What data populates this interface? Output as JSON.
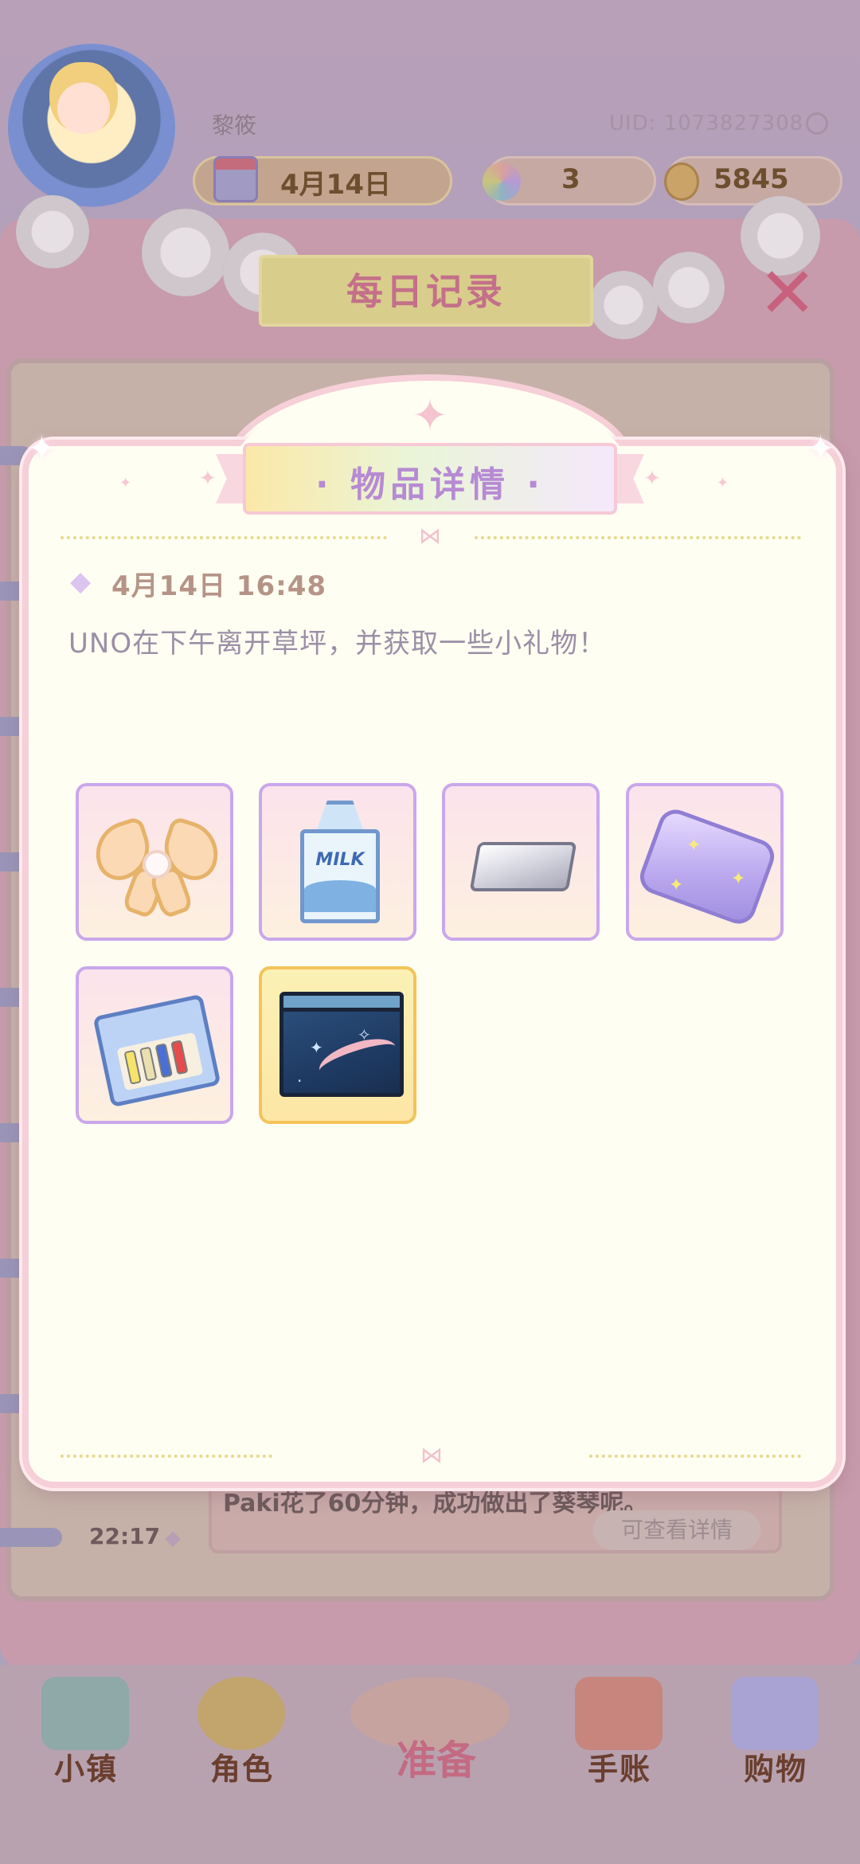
{
  "player": {
    "name": "黎筱",
    "uid": "UID: 1073827308",
    "date": "4月14日",
    "gems": "3",
    "coins": "5845"
  },
  "background": {
    "header_title": "每日记录",
    "close_symbol": "✕",
    "log_time": "22:17",
    "log_text": "Paki花了60分钟，成功做出了葵琴呢。",
    "detail_button": "可查看详情"
  },
  "modal": {
    "title": "· 物品详情 ·",
    "entry_datetime": "4月14日  16:48",
    "entry_text": "UNO在下午离开草坪，并获取一些小礼物！",
    "items": [
      {
        "icon": "bow-hairclip-icon"
      },
      {
        "icon": "milk-carton-icon"
      },
      {
        "icon": "silver-ingot-icon"
      },
      {
        "icon": "star-pillow-icon"
      },
      {
        "icon": "paint-set-icon"
      },
      {
        "icon": "starry-box-icon",
        "rarity": "gold"
      }
    ],
    "milk_label": "MILK"
  },
  "bottom_nav": {
    "items": [
      {
        "label": "小镇",
        "icon": "town-icon"
      },
      {
        "label": "角色",
        "icon": "character-icon"
      },
      {
        "label": "准备",
        "icon": "prepare-icon"
      },
      {
        "label": "手账",
        "icon": "journal-icon"
      },
      {
        "label": "购物",
        "icon": "shopping-bag-icon"
      }
    ]
  },
  "colors": {
    "modal_bg": "#fffef2",
    "modal_border": "#f6cfd8",
    "title_text": "#b78ad4",
    "slot_border": "#c9a7ec",
    "gold_slot_border": "#f3c35a"
  }
}
